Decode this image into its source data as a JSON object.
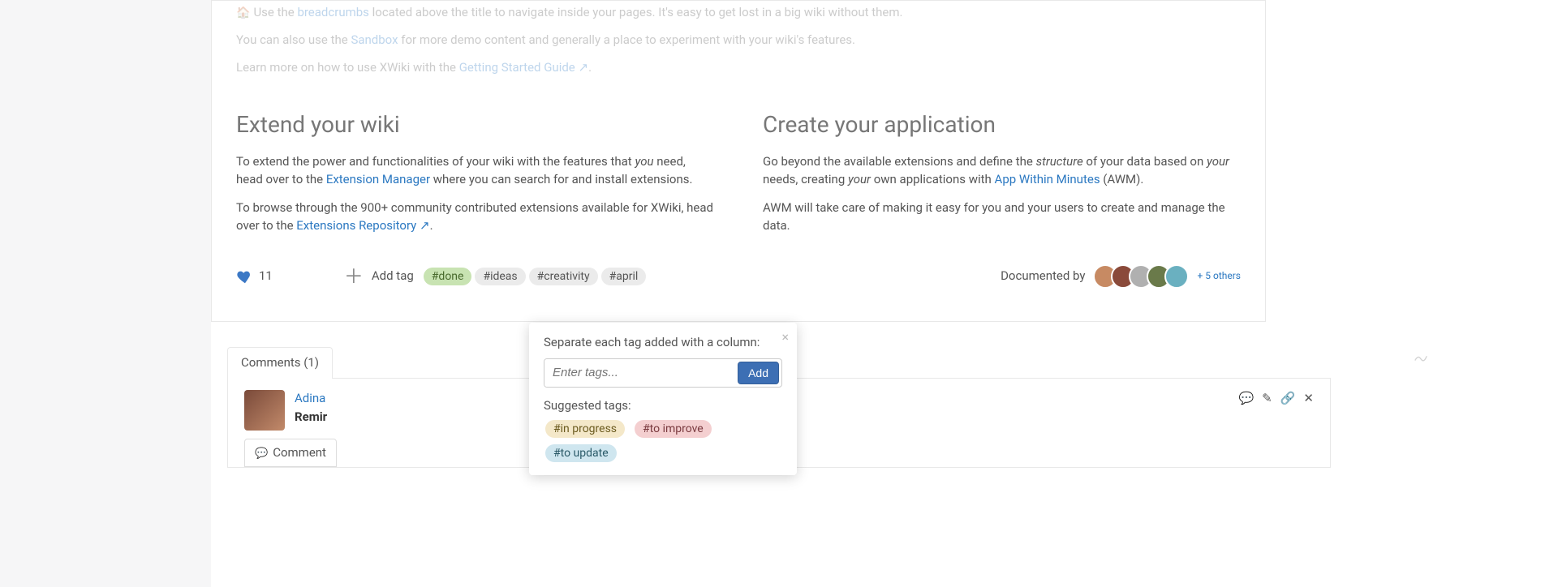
{
  "intro": {
    "line1_prefix": "Use the",
    "line1_link": " breadcrumbs ",
    "line1_rest": "located above the title to navigate inside your pages. It's easy to get lost in a big wiki without them.",
    "line2_prefix": "You can also use the ",
    "line2_link": "Sandbox",
    "line2_rest": " for more demo content and generally a place to experiment with your wiki's features.",
    "line3_prefix": " Learn more on how to use XWiki with the ",
    "line3_link": "Getting Started Guide",
    "line3_suffix": "."
  },
  "extend": {
    "heading": "Extend your wiki",
    "p1a": "To extend the power and functionalities of your wiki with the features that ",
    "p1_you": "you",
    "p1b": " need, head over to the ",
    "p1_link": "Extension Manager",
    "p1c": " where you can search for and install extensions.",
    "p2a": "To browse through the 900+ community contributed extensions available for XWiki, head over to the ",
    "p2_link": "Extensions Repository",
    "p2b": "."
  },
  "create": {
    "heading": "Create your application",
    "p1a": "Go beyond the available extensions and define the ",
    "p1_structure": "structure",
    "p1b": " of your data based on ",
    "p1_your1": "your",
    "p1c": " needs, creating ",
    "p1_your2": "your",
    "p1d": " own applications with ",
    "p1_link": "App Within Minutes",
    "p1e": " (AWM).",
    "p2": "AWM will take care of making it easy for you and your users to create and manage the data."
  },
  "footer": {
    "likes": "11",
    "addtag": "Add tag",
    "tags": [
      "#done",
      "#ideas",
      "#creativity",
      "#april"
    ],
    "docby": "Documented by",
    "others": "+ 5 others",
    "avatar_colors": [
      "#c78a63",
      "#8a4a3a",
      "#b0b0b0",
      "#6a7a4a",
      "#6ab0c0"
    ]
  },
  "popover": {
    "label": "Separate each tag added with a column:",
    "placeholder": "Enter tags...",
    "add": "Add",
    "suggest_label": "Suggested tags:",
    "suggested": [
      "#in progress",
      "#to improve",
      "#to update"
    ]
  },
  "comments": {
    "tab": "Comments (1)",
    "user": "Adina",
    "body": "Remir",
    "btn": "Comment"
  }
}
